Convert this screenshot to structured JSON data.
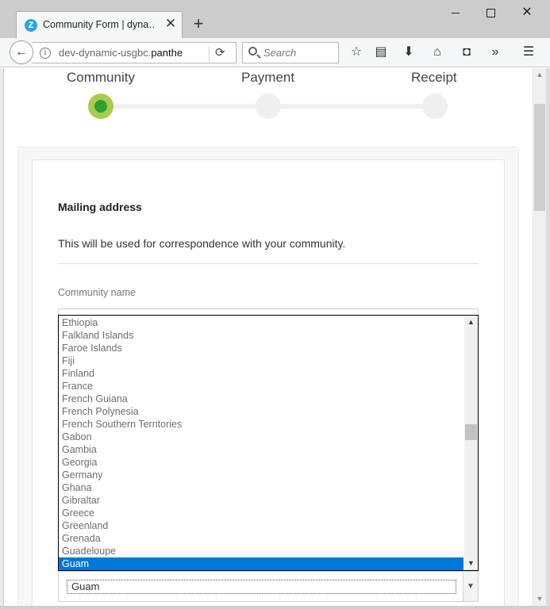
{
  "browser": {
    "tab_title": "Community Form | dyna…",
    "favicon_letter": "Z",
    "new_tab_symbol": "+",
    "url_prefix": "dev-dynamic-usgbc.",
    "url_domain": "panthe",
    "search_placeholder": "Search"
  },
  "steps": [
    {
      "label": "Community",
      "state": "active"
    },
    {
      "label": "Payment",
      "state": "inactive"
    },
    {
      "label": "Receipt",
      "state": "inactive"
    }
  ],
  "form": {
    "section_heading": "Mailing address",
    "section_description": "This will be used for correspondence with your community.",
    "community_name_label": "Community name",
    "country_options": [
      "Ethiopia",
      "Falkland Islands",
      "Faroe Islands",
      "Fiji",
      "Finland",
      "France",
      "French Guiana",
      "French Polynesia",
      "French Southern Territories",
      "Gabon",
      "Gambia",
      "Georgia",
      "Germany",
      "Ghana",
      "Gibraltar",
      "Greece",
      "Greenland",
      "Grenada",
      "Guadeloupe",
      "Guam"
    ],
    "selected_country": "Guam",
    "dropdown_scroll_fraction": 0.45
  },
  "colors": {
    "step_active_outer": "#a7cc52",
    "step_active_inner": "#2ea02e",
    "selection_highlight": "#0078d7"
  }
}
